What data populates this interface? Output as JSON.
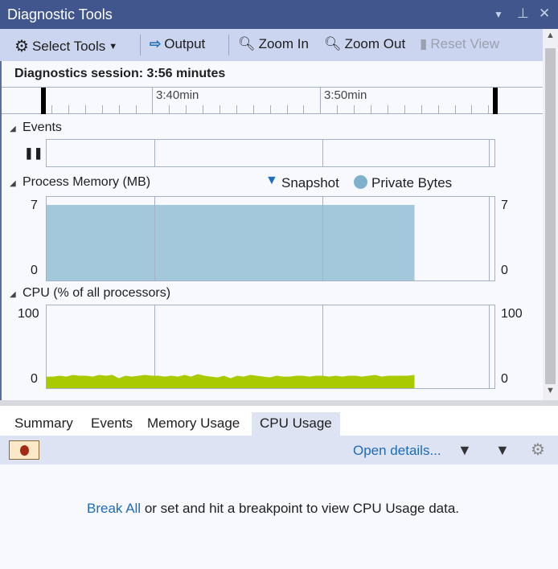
{
  "window": {
    "title": "Diagnostic Tools"
  },
  "toolbar": {
    "select_tools": "Select Tools",
    "output": "Output",
    "zoom_in": "Zoom In",
    "zoom_out": "Zoom Out",
    "reset_view": "Reset View"
  },
  "session": {
    "label": "Diagnostics session: 3:56 minutes"
  },
  "ruler": {
    "ticks": [
      "3:40min",
      "3:50min"
    ]
  },
  "events": {
    "title": "Events"
  },
  "memory": {
    "title": "Process Memory (MB)",
    "legend": [
      "Snapshot",
      "Private Bytes"
    ],
    "y_max_label": "7",
    "y_min_label": "0"
  },
  "cpu": {
    "title": "CPU (% of all processors)",
    "y_max_label": "100",
    "y_min_label": "0"
  },
  "colors": {
    "titlebar": "#40568d",
    "memory_fill": "#a3c8dc",
    "cpu_fill": "#a9c900",
    "snapshot": "#1c6fc2",
    "link": "#1e6bb8",
    "record": "#a52a14"
  },
  "chart_data": [
    {
      "type": "area",
      "title": "Process Memory (MB)",
      "x_unit": "time (m:ss)",
      "xlim": [
        "3:33",
        "4:01"
      ],
      "ylim": [
        0,
        7
      ],
      "series": [
        {
          "name": "Private Bytes",
          "x": [
            "3:33",
            "3:56"
          ],
          "values": [
            7,
            7
          ]
        }
      ]
    },
    {
      "type": "area",
      "title": "CPU (% of all processors)",
      "xlim": [
        "3:33",
        "4:01"
      ],
      "ylim": [
        0,
        100
      ],
      "series": [
        {
          "values": [
            14,
            14,
            15,
            14,
            16,
            15,
            15,
            14,
            16,
            15,
            16,
            12,
            15,
            14,
            15,
            16,
            15,
            15,
            14,
            15,
            14,
            16,
            14,
            17,
            15,
            14,
            13,
            15,
            12,
            15,
            14,
            16,
            15,
            14,
            13,
            15,
            14,
            14,
            15,
            15,
            14,
            15,
            15,
            14,
            15,
            14,
            15,
            15,
            14,
            15,
            16,
            14,
            15,
            15,
            15,
            15,
            16
          ]
        }
      ]
    }
  ],
  "tabs": [
    "Summary",
    "Events",
    "Memory Usage",
    "CPU Usage"
  ],
  "details": {
    "open_details": "Open details...",
    "break_all": "Break All",
    "message": " or set and hit a breakpoint to view CPU Usage data."
  }
}
